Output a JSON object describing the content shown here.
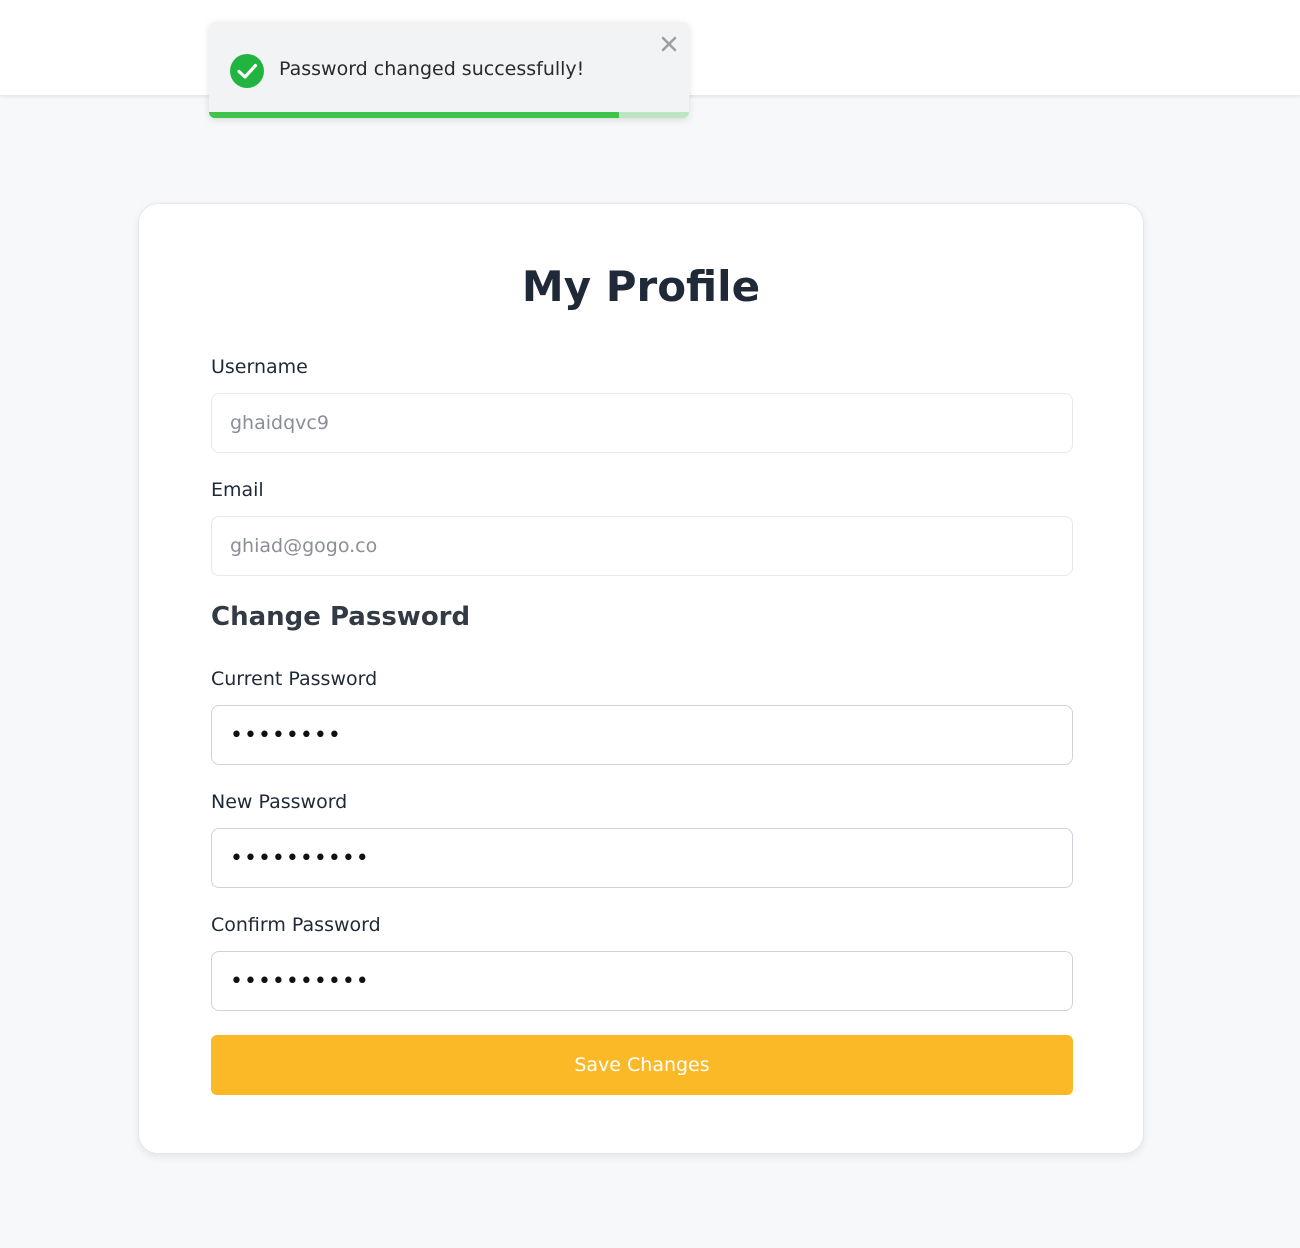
{
  "toast": {
    "message": "Password changed successfully!",
    "progress": 0.855,
    "success_color": "#22b440",
    "progress_color": "#3ec44a"
  },
  "profile": {
    "title": "My Profile",
    "username_label": "Username",
    "username_value": "ghaidqvc9",
    "email_label": "Email",
    "email_value": "ghiad@gogo.co",
    "change_password_heading": "Change Password",
    "current_password_label": "Current Password",
    "current_password_value": "••••••••",
    "new_password_label": "New Password",
    "new_password_value": "••••••••••",
    "confirm_password_label": "Confirm Password",
    "confirm_password_value": "••••••••••",
    "save_label": "Save Changes",
    "save_color": "#fbb928"
  }
}
